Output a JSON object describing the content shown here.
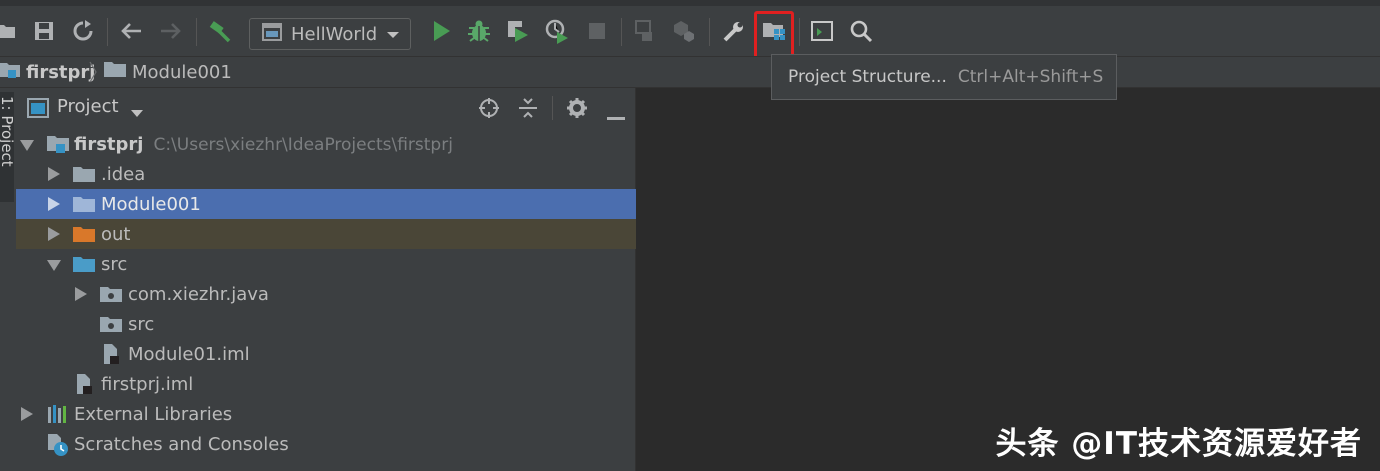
{
  "toolbar": {
    "run_config": "HellWorld",
    "icons": [
      "open-icon",
      "save-icon",
      "sync-icon",
      "back-icon",
      "forward-icon",
      "build-icon",
      "run-icon",
      "debug-icon",
      "coverage-icon",
      "profile-icon",
      "stop-icon",
      "attach-icon",
      "build-artifacts-icon",
      "settings-wrench-icon",
      "project-structure-icon",
      "terminal-icon",
      "search-icon"
    ],
    "colors": {
      "run": "#499c54",
      "debug": "#59a869",
      "highlight": "#e02020"
    }
  },
  "breadcrumb": {
    "project": "firstprj",
    "module": "Module001"
  },
  "tooltip": {
    "label": "Project Structure...",
    "shortcut": "Ctrl+Alt+Shift+S"
  },
  "project_panel": {
    "title": "Project",
    "strip_label": "1: Project",
    "tree": [
      {
        "label": "firstprj",
        "path": "C:\\Users\\xiezhr\\IdeaProjects\\firstprj"
      },
      {
        "label": ".idea"
      },
      {
        "label": "Module001"
      },
      {
        "label": "out"
      },
      {
        "label": "src"
      },
      {
        "label": "com.xiezhr.java"
      },
      {
        "label": "src"
      },
      {
        "label": "Module01.iml"
      },
      {
        "label": "firstprj.iml"
      },
      {
        "label": "External Libraries"
      },
      {
        "label": "Scratches and Consoles"
      }
    ]
  },
  "watermark": "头条 @IT技术资源爱好者"
}
